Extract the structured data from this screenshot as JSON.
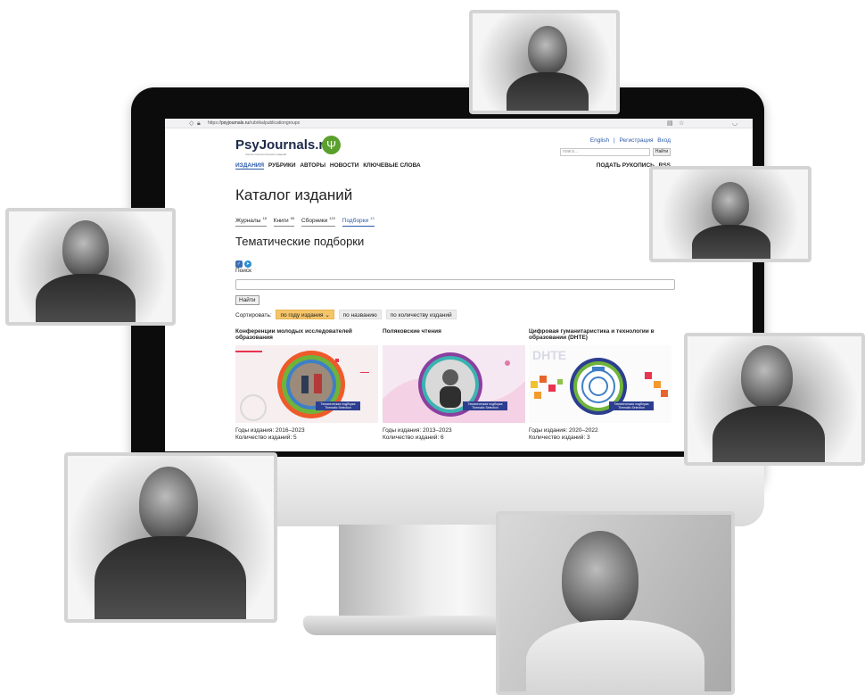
{
  "browser": {
    "url_prefix": "https://",
    "url_domain": "psyjournals.ru",
    "url_path": "/rubrikalpublicationgroups"
  },
  "site": {
    "logo_text": "PsyJournals.ru",
    "logo_subtitle": "портал психологических изданий",
    "top_links": [
      "English",
      "|",
      "Регистрация",
      "Вход"
    ],
    "top_search_placeholder": "поиск...",
    "top_search_button": "Найти",
    "nav": [
      "ИЗДАНИЯ",
      "РУБРИКИ",
      "АВТОРЫ",
      "НОВОСТИ",
      "КЛЮЧЕВЫЕ СЛОВА"
    ],
    "nav_right": [
      "ПОДАТЬ РУКОПИСЬ",
      "RSS"
    ]
  },
  "main": {
    "title": "Каталог изданий",
    "tabs": [
      {
        "label": "Журналы",
        "count": "18"
      },
      {
        "label": "Книги",
        "count": "55"
      },
      {
        "label": "Сборники",
        "count": "122"
      },
      {
        "label": "Подборки",
        "count": "13"
      }
    ],
    "subtitle": "Тематические подборки",
    "search_label": "Поиск",
    "search_button": "Найти",
    "sort_label": "Сортировать:",
    "sort_options": [
      "по году издания ⌄",
      "по названию",
      "по количеству изданий"
    ]
  },
  "cards": [
    {
      "title": "Конференции молодых исследователей образования",
      "years": "Годы издания: 2016–2023",
      "count": "Количество изданий: 5",
      "badge": "Тематическая подборка Thematic Selection"
    },
    {
      "title": "Поляковские чтения",
      "years": "Годы издания: 2013–2023",
      "count": "Количество изданий: 6",
      "badge": "Тематическая подборка Thematic Selection"
    },
    {
      "title": "Цифровая гуманитаристика и технологии в образовании (DHTE)",
      "years": "Годы издания: 2020–2022",
      "count": "Количество изданий: 3",
      "badge": "Тематическая подборка Thematic Selection",
      "image_text": "DHTE"
    }
  ]
}
